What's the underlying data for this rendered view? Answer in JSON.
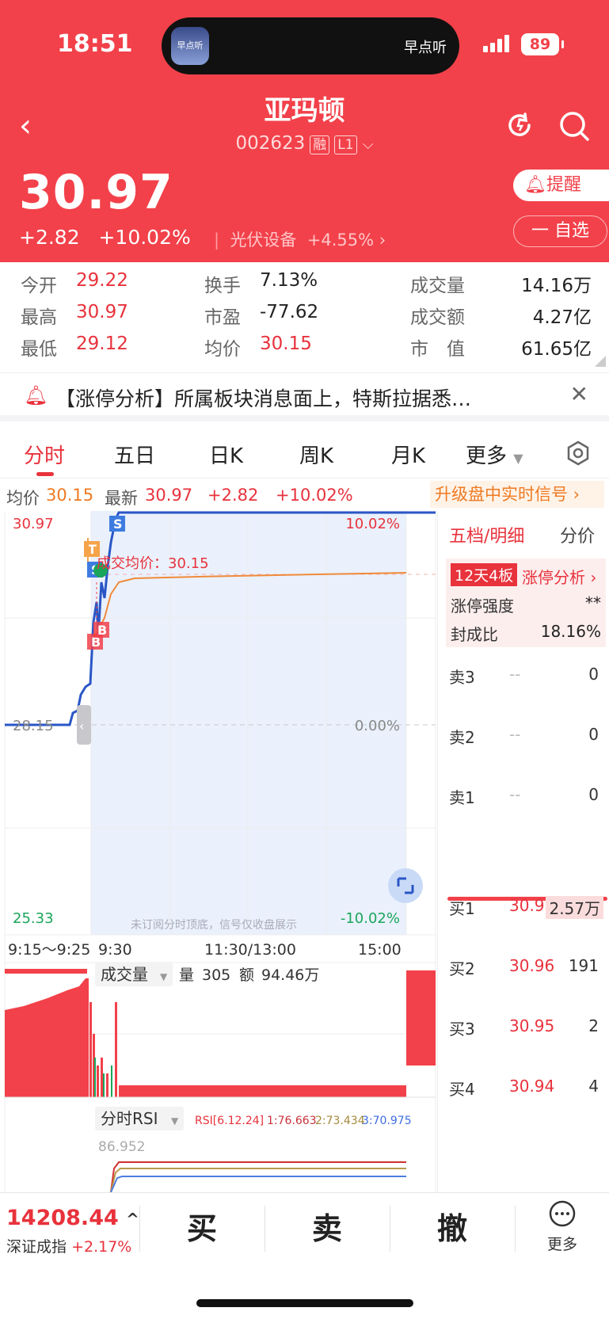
{
  "status": {
    "time": "18:51",
    "island_label": "早点听",
    "app_icon_text": "早点听",
    "battery": "89"
  },
  "header": {
    "name": "亚玛顿",
    "code": "002623",
    "tag1": "融",
    "tag2": "L1"
  },
  "quote": {
    "price": "30.97",
    "change": "+2.82",
    "change_pct": "+10.02%",
    "sector": "光伏设备",
    "sector_pct": "+4.55%",
    "remind": "提醒",
    "watch": "一 自选"
  },
  "stats": {
    "open_label": "今开",
    "open": "29.22",
    "high_label": "最高",
    "high": "30.97",
    "low_label": "最低",
    "low": "29.12",
    "turnover_label": "换手",
    "turnover": "7.13%",
    "pe_label": "市盈",
    "pe": "-77.62",
    "avg_label": "均价",
    "avg": "30.15",
    "vol_label": "成交量",
    "vol": "14.16万",
    "amt_label": "成交额",
    "amt": "4.27亿",
    "mcap_label": "市　值",
    "mcap": "61.65亿"
  },
  "notice": {
    "text": "【涨停分析】所属板块消息面上，特斯拉据悉…"
  },
  "tabs": [
    "分时",
    "五日",
    "日K",
    "周K",
    "月K",
    "更多"
  ],
  "chart_header": {
    "avg_label": "均价",
    "avg": "30.15",
    "latest_label": "最新",
    "latest": "30.97",
    "change": "+2.82",
    "pct": "+10.02%",
    "upgrade": "升级盘中实时信号"
  },
  "chart": {
    "ymax": "30.97",
    "ymid": "28.15",
    "ymin": "25.33",
    "pct_top": "10.02%",
    "pct_mid": "0.00%",
    "pct_bot": "-10.02%",
    "avg_note": "成交均价：30.15",
    "watermark": "未订阅分时顶底，信号仅收盘展示",
    "times": [
      "9:15～9:25",
      "9:30",
      "11:30/13:00",
      "15:00"
    ],
    "marker_T": "T",
    "marker_S": "S",
    "marker_B": "B",
    "vol_label": "成交量",
    "vol_qty_label": "量",
    "vol_qty": "305",
    "vol_amt_label": "额",
    "vol_amt": "94.46万",
    "rsi_label": "分时RSI",
    "rsi_params": "RSI[6.12.24]",
    "rsi1": "1:76.663",
    "rsi2": "2:73.434",
    "rsi3": "3:70.975",
    "rsi_axis": "86.952",
    "colors": {
      "price": "#2a56c6",
      "avg": "#f08a3a",
      "up": "#f2414a",
      "down": "#1aa55b"
    }
  },
  "chart_data": {
    "type": "line",
    "title": "",
    "series": [],
    "x": [
      "9:15",
      "9:30",
      "11:30/13:00",
      "15:00"
    ],
    "ylim": [
      25.33,
      30.97
    ],
    "prev_close": 28.15,
    "close": 30.97,
    "avg": 30.15
  },
  "order_book": {
    "title": "五档/明细",
    "alt": "分价",
    "badge": "12天4板",
    "badge_link": "涨停分析",
    "strength_label": "涨停强度",
    "strength": "**",
    "seal_label": "封成比",
    "seal": "18.16%",
    "asks": [
      {
        "label": "卖3",
        "price": "--",
        "qty": "0"
      },
      {
        "label": "卖2",
        "price": "--",
        "qty": "0"
      },
      {
        "label": "卖1",
        "price": "--",
        "qty": "0"
      }
    ],
    "bids": [
      {
        "label": "买1",
        "price": "30.97",
        "qty": "2.57万"
      },
      {
        "label": "买2",
        "price": "30.96",
        "qty": "191"
      },
      {
        "label": "买3",
        "price": "30.95",
        "qty": "2"
      },
      {
        "label": "买4",
        "price": "30.94",
        "qty": "4"
      }
    ]
  },
  "bottom": {
    "index_value": "14208.44",
    "index_name": "深证成指",
    "index_pct": "+2.17%",
    "buy": "买",
    "sell": "卖",
    "cancel": "撤",
    "more": "更多"
  }
}
